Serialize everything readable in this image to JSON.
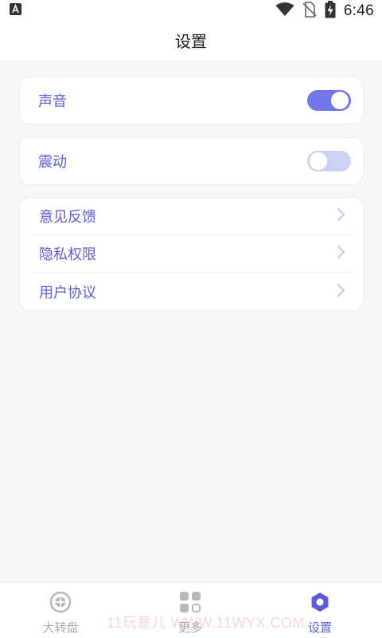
{
  "status_bar": {
    "time": "6:46",
    "icons": [
      "app-notification-icon",
      "wifi-icon",
      "no-sim-icon",
      "battery-charging-icon"
    ]
  },
  "header": {
    "title": "设置"
  },
  "settings": {
    "toggles": [
      {
        "label": "声音",
        "state": "on"
      },
      {
        "label": "震动",
        "state": "off"
      }
    ],
    "links": [
      {
        "label": "意见反馈"
      },
      {
        "label": "隐私权限"
      },
      {
        "label": "用户协议"
      }
    ]
  },
  "bottom_nav": {
    "tabs": [
      {
        "label": "大转盘",
        "icon": "wheel-icon",
        "active": false
      },
      {
        "label": "更多",
        "icon": "grid-icon",
        "active": false
      },
      {
        "label": "设置",
        "icon": "gear-icon",
        "active": true
      }
    ]
  },
  "watermark": "11玩意儿 WWW.11WYX.COM",
  "colors": {
    "accent": "#5b5fd6",
    "toggle_on": "#7376e8",
    "toggle_off": "#cfd0f6",
    "inactive": "#aaaaaa"
  }
}
